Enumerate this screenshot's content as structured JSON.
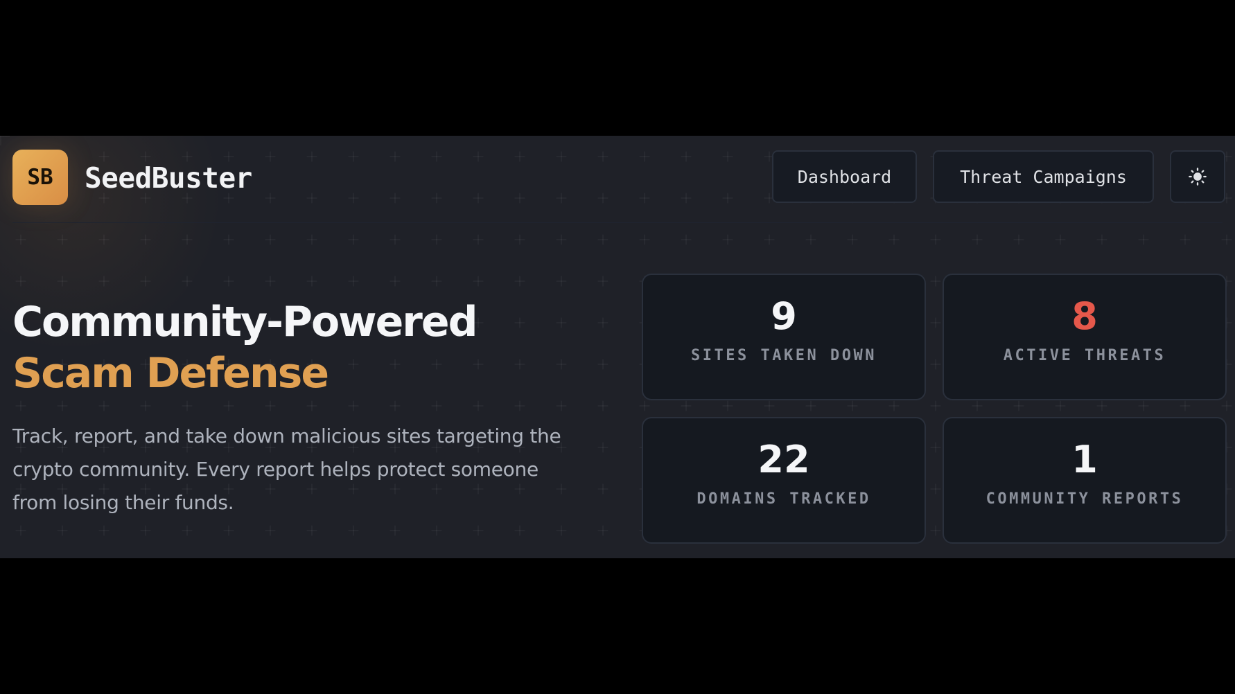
{
  "brand": {
    "logo_text": "SB",
    "name": "SeedBuster"
  },
  "nav": {
    "dashboard": "Dashboard",
    "campaigns": "Threat Campaigns",
    "theme_icon": "sun-icon"
  },
  "hero": {
    "title_main": "Community-Powered ",
    "title_accent": "Scam Defense",
    "description": "Track, report, and take down malicious sites targeting the crypto community. Every report helps protect someone from losing their funds."
  },
  "stats": [
    {
      "value": "9",
      "label": "SITES TAKEN DOWN",
      "color": "#f5f6f8"
    },
    {
      "value": "8",
      "label": "ACTIVE THREATS",
      "color": "#e5584b"
    },
    {
      "value": "22",
      "label": "DOMAINS TRACKED",
      "color": "#f5f6f8"
    },
    {
      "value": "1",
      "label": "COMMUNITY REPORTS",
      "color": "#f5f6f8"
    }
  ],
  "colors": {
    "accent": "#e0a052",
    "danger": "#e5584b",
    "background": "#0e1118"
  }
}
